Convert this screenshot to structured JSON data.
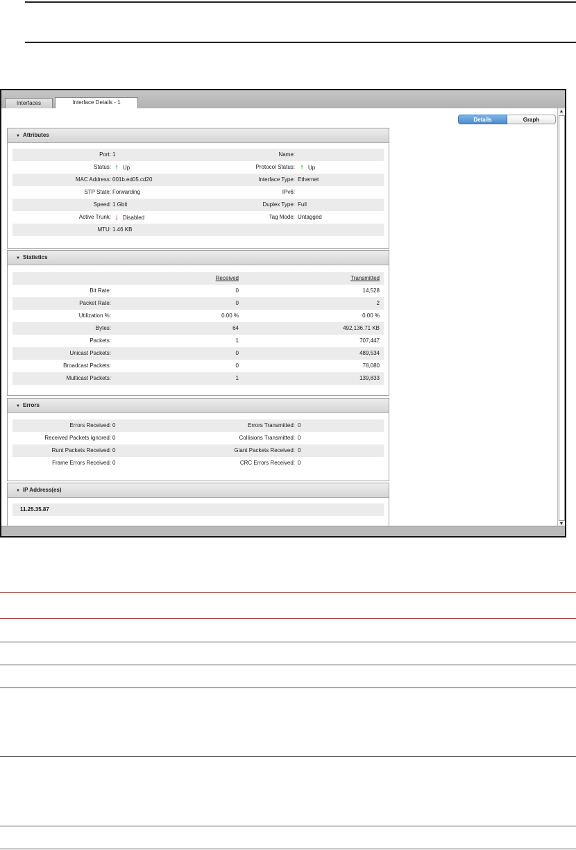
{
  "tabs": [
    {
      "label": "Interfaces",
      "active": false
    },
    {
      "label": "Interface Details - 1",
      "active": true
    }
  ],
  "view_toggle": {
    "details": "Details",
    "graph": "Graph",
    "selected": "Details"
  },
  "attributes": {
    "title": "Attributes",
    "rows": [
      {
        "l_label": "Port:",
        "l_value": "1",
        "r_label": "Name:",
        "r_value": ""
      },
      {
        "l_label": "Status:",
        "l_value": "Up",
        "l_icon": "up",
        "r_label": "Protocol Status:",
        "r_value": "Up",
        "r_icon": "up"
      },
      {
        "l_label": "MAC Address:",
        "l_value": "001b.ed05.cd20",
        "r_label": "Interface Type:",
        "r_value": "Ethernet"
      },
      {
        "l_label": "STP State:",
        "l_value": "Forwarding",
        "r_label": "IPv6:",
        "r_value": ""
      },
      {
        "l_label": "Speed:",
        "l_value": "1 Gbit",
        "r_label": "Duplex Type:",
        "r_value": "Full"
      },
      {
        "l_label": "Active Trunk:",
        "l_value": "Disabled",
        "l_icon": "down",
        "r_label": "Tag Mode:",
        "r_value": "Untagged"
      },
      {
        "l_label": "MTU:",
        "l_value": "1.46 KB",
        "r_label": "",
        "r_value": ""
      }
    ]
  },
  "statistics": {
    "title": "Statistics",
    "col_received": "Received",
    "col_transmitted": "Transmitted",
    "rows": [
      {
        "label": "Bit Rate:",
        "received": "0",
        "transmitted": "14,528"
      },
      {
        "label": "Packet Rate:",
        "received": "0",
        "transmitted": "2"
      },
      {
        "label": "Utilization %:",
        "received": "0.00 %",
        "transmitted": "0.00 %"
      },
      {
        "label": "Bytes:",
        "received": "64",
        "transmitted": "492,136.71 KB"
      },
      {
        "label": "Packets:",
        "received": "1",
        "transmitted": "707,447"
      },
      {
        "label": "Unicast Packets:",
        "received": "0",
        "transmitted": "489,534"
      },
      {
        "label": "Broadcast Packets:",
        "received": "0",
        "transmitted": "78,080"
      },
      {
        "label": "Multicast Packets:",
        "received": "1",
        "transmitted": "139,833"
      }
    ]
  },
  "errors": {
    "title": "Errors",
    "rows": [
      {
        "l_label": "Errors Received:",
        "l_value": "0",
        "r_label": "Errors Transmitted:",
        "r_value": "0"
      },
      {
        "l_label": "Received Packets Ignored:",
        "l_value": "0",
        "r_label": "Collisions Transmitted:",
        "r_value": "0"
      },
      {
        "l_label": "Runt Packets Received:",
        "l_value": "0",
        "r_label": "Giant Packets Received:",
        "r_value": "0"
      },
      {
        "l_label": "Frame Errors Received:",
        "l_value": "0",
        "r_label": "CRC Errors Received:",
        "r_value": "0"
      }
    ]
  },
  "ip_addresses": {
    "title": "IP Address(es)",
    "items": [
      "11.25.35.87"
    ]
  },
  "colors": {
    "status_up": "#1a9a1a",
    "status_down": "#d41f1f",
    "accent_selected": "#4d8ccd",
    "document_rule": "#d22222"
  }
}
